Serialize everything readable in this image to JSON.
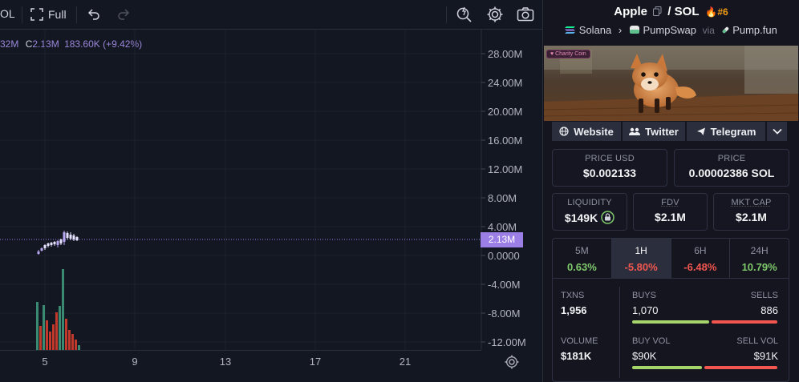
{
  "toolbar": {
    "symbol_fragment": "OL",
    "full_label": "Full"
  },
  "legend": {
    "prefix_fragment": "32M",
    "close_label": "C",
    "close_value": "2.13M",
    "change_text": "183.60K (+9.42%)"
  },
  "price_axis": {
    "labels": [
      "28.00M",
      "24.00M",
      "20.00M",
      "16.00M",
      "12.00M",
      "8.00M",
      "4.00M",
      "0.0000",
      "-4.00M",
      "-8.00M",
      "-12.00M"
    ],
    "current_price": "2.13M"
  },
  "time_axis": {
    "labels": [
      "5",
      "9",
      "13",
      "17",
      "21"
    ]
  },
  "colors": {
    "up": "#7ec86a",
    "down": "#f2564f",
    "accent": "#9b7fe6",
    "volume_up": "#3a8a72",
    "volume_down": "#c0392b"
  },
  "pair": {
    "base": "Apple",
    "quote": "SOL",
    "rank": "#6",
    "chain": "Solana",
    "dex": "PumpSwap",
    "via": "via",
    "launchpad": "Pump.fun"
  },
  "banner": {
    "badge": "Charity Coin"
  },
  "socials": {
    "website": "Website",
    "twitter": "Twitter",
    "telegram": "Telegram"
  },
  "price": {
    "usd_label": "PRICE USD",
    "usd_value": "$0.002133",
    "native_label": "PRICE",
    "native_value": "0.00002386 SOL"
  },
  "metrics": {
    "liquidity_label": "LIQUIDITY",
    "liquidity_value": "$149K",
    "fdv_label": "FDV",
    "fdv_value": "$2.1M",
    "mktcap_label": "MKT CAP",
    "mktcap_value": "$2.1M"
  },
  "timeframes": [
    {
      "label": "5M",
      "change": "0.63%",
      "direction": "up"
    },
    {
      "label": "1H",
      "change": "-5.80%",
      "direction": "down"
    },
    {
      "label": "6H",
      "change": "-6.48%",
      "direction": "down"
    },
    {
      "label": "24H",
      "change": "10.79%",
      "direction": "up"
    }
  ],
  "stats": {
    "txns_label": "TXNS",
    "txns_value": "1,956",
    "buys_label": "BUYS",
    "buys_value": "1,070",
    "sells_label": "SELLS",
    "sells_value": "886",
    "buy_share": 0.547,
    "volume_label": "VOLUME",
    "volume_value": "$181K",
    "buyvol_label": "BUY VOL",
    "buyvol_value": "$90K",
    "sellvol_label": "SELL VOL",
    "sellvol_value": "$91K",
    "buyvol_share": 0.497
  }
}
